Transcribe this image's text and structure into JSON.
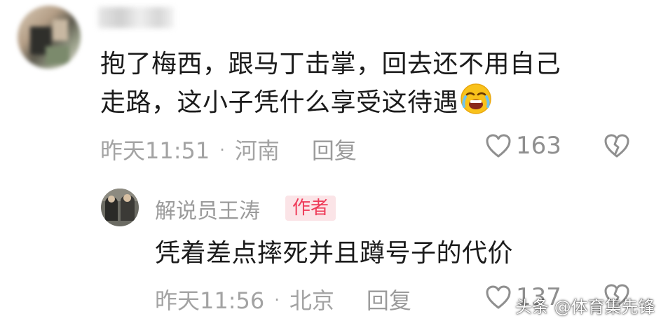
{
  "top_comment": {
    "text_line1": "抱了梅西，跟马丁击掌，回去还不用自己",
    "text_line2": "走路，这小子凭什么享受这待遇",
    "emoji": "crying-face-icon",
    "time": "昨天11:51",
    "location": "河南",
    "reply_label": "回复",
    "like_count": "163"
  },
  "reply_comment": {
    "username": "解说员王涛",
    "badge": "作者",
    "text": "凭着差点摔死并且蹲号子的代价",
    "time": "昨天11:56",
    "location": "北京",
    "reply_label": "回复",
    "like_count": "137"
  },
  "separator": "·",
  "watermark": "头条 @体育集先锋",
  "colors": {
    "text": "#1b1b1b",
    "meta": "#a3a3a3",
    "badge_bg": "#fbe4e7",
    "badge_text": "#ee3b59"
  }
}
